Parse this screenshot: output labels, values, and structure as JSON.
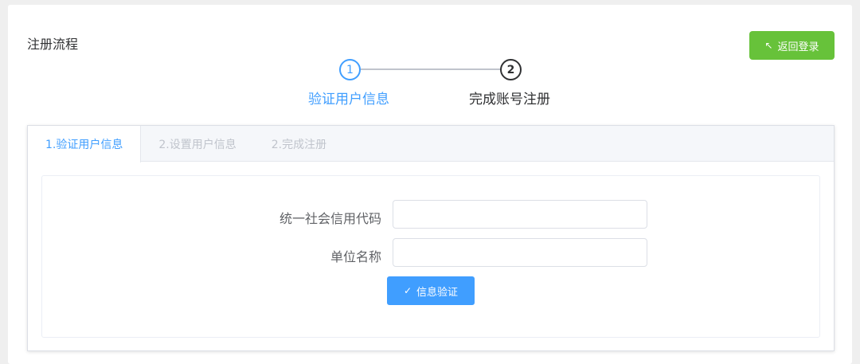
{
  "header": {
    "title": "注册流程",
    "back_label": "返回登录",
    "back_icon": "↖"
  },
  "steps": [
    {
      "number": "1",
      "label": "验证用户信息",
      "state": "active"
    },
    {
      "number": "2",
      "label": "完成账号注册",
      "state": "done"
    }
  ],
  "tabs": [
    {
      "label": "1.验证用户信息",
      "active": true
    },
    {
      "label": "2.设置用户信息",
      "active": false
    },
    {
      "label": "2.完成注册",
      "active": false
    }
  ],
  "form": {
    "credit_code_label": "统一社会信用代码",
    "credit_code_value": "",
    "unit_name_label": "单位名称",
    "unit_name_value": "",
    "verify_label": "信息验证",
    "verify_icon": "✓"
  },
  "colors": {
    "primary": "#409eff",
    "success": "#67c23a",
    "text": "#303133"
  }
}
